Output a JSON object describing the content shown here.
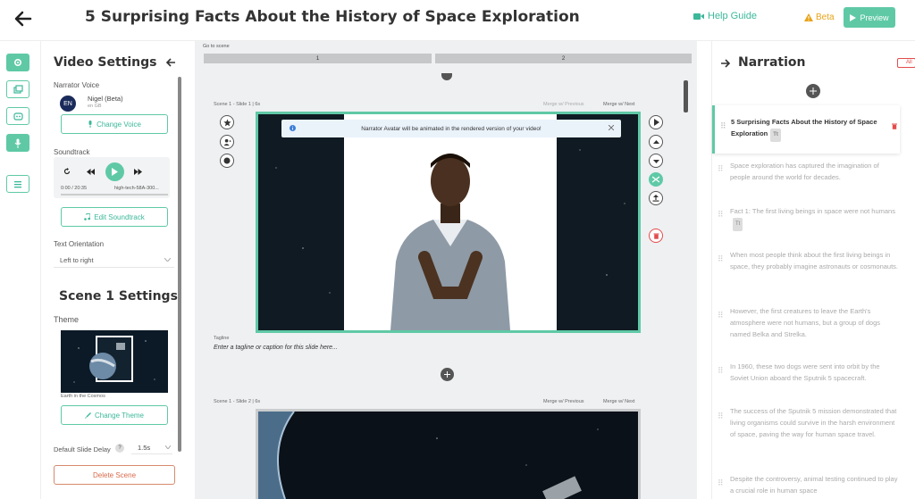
{
  "header": {
    "title": "5 Surprising Facts About the History of Space Exploration",
    "help_label": "Help Guide",
    "beta_label": "Beta",
    "preview_label": "Preview"
  },
  "colors": {
    "accent": "#5fc9a6",
    "accent_text": "#3cb89a",
    "warning": "#e8a317",
    "danger": "#e34c4c"
  },
  "settings": {
    "heading": "Video Settings",
    "narrator_voice_label": "Narrator Voice",
    "narrator_code": "EN",
    "narrator_name": "Nigel (Beta)",
    "narrator_locale": "en GB",
    "change_voice": "Change Voice",
    "soundtrack_label": "Soundtrack",
    "time": "0:00 / 20:35",
    "track_name": "high-tech-58A-300...",
    "edit_soundtrack": "Edit Soundtrack",
    "text_orientation_label": "Text Orientation",
    "text_orientation_value": "Left to right",
    "scene_heading": "Scene 1 Settings",
    "theme_label": "Theme",
    "theme_name": "Earth in the Cosmos",
    "change_theme": "Change Theme",
    "delay_label": "Default Slide Delay",
    "delay_help": "?",
    "delay_value": "1.5s",
    "delete_scene": "Delete Scene"
  },
  "editor": {
    "go_to_scene": "Go to scene",
    "scenes": [
      "1",
      "2"
    ],
    "slide1_meta": "Scene 1 - Slide 1 | 6s",
    "slide2_meta": "Scene 1 - Slide 2 | 6s",
    "merge_prev": "Merge w/ Previous",
    "merge_next": "Merge w/ Next",
    "notice": "Narrator Avatar will be animated in the rendered version of your video!",
    "tagline_label": "Tagline",
    "tagline_placeholder": "Enter a tagline or caption for this slide here..."
  },
  "narration": {
    "heading": "Narration",
    "all_label": "All",
    "active_title": "5 Surprising Facts About the History of Space Exploration",
    "active_badge": "Tt",
    "items": [
      "Space exploration has captured the imagination of people around the world for decades.",
      "Fact 1: The first living beings in space were not humans",
      "When most people think about the first living beings in space, they probably imagine astronauts or cosmonauts.",
      "However, the first creatures to leave the Earth's atmosphere were not humans, but a group of dogs named Belka and Strelka.",
      "In 1960, these two dogs were sent into orbit by the Soviet Union aboard the Sputnik 5 spacecraft.",
      "The success of the Sputnik 5 mission demonstrated that living organisms could survive in the harsh environment of space, paving the way for human space travel.",
      "Despite the controversy, animal testing continued to play a crucial role in human space"
    ],
    "item_badge": "Tt"
  }
}
